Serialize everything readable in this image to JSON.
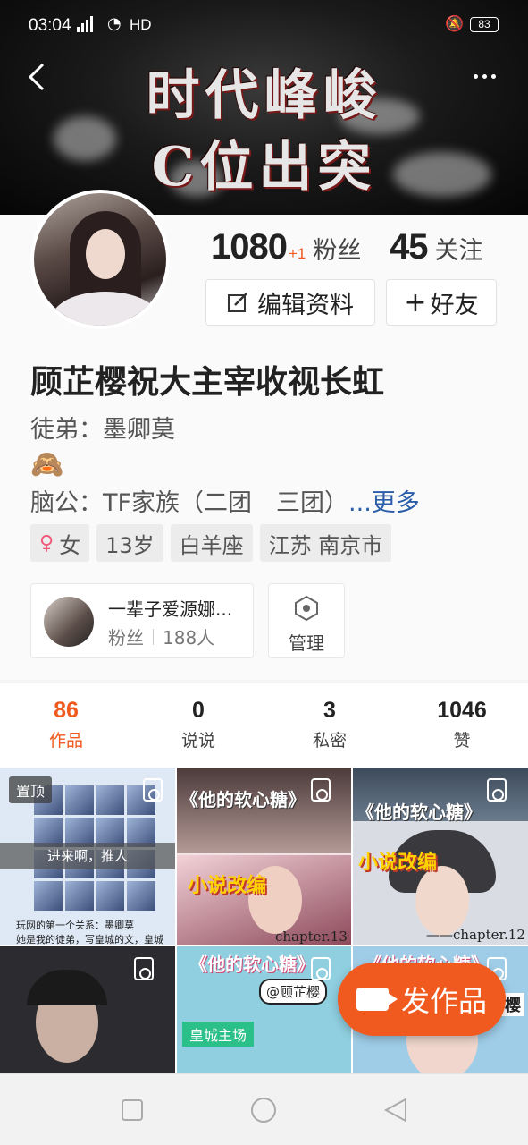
{
  "status_bar": {
    "time": "03:04",
    "network": "4G",
    "hd": "HD",
    "battery": "83"
  },
  "banner": {
    "line1": "时代峰峻",
    "line2": "C位出突"
  },
  "profile": {
    "fans_count": "1080",
    "fans_delta": "+1",
    "fans_label": "粉丝",
    "follow_count": "45",
    "follow_label": "关注",
    "edit_button": "编辑资料",
    "add_friend_button": "好友",
    "name": "顾芷樱祝大主宰收视长虹",
    "bio_line1": "徒弟：墨卿莫",
    "bio_line2": "🙈",
    "bio_line3": "脑公：TF家族（二团　三团）",
    "bio_more": "...更多",
    "tags": {
      "gender": "女",
      "age": "13岁",
      "zodiac": "白羊座",
      "location": "江苏 南京市"
    }
  },
  "group": {
    "name": "一辈子爱源娜...",
    "members_label": "粉丝",
    "members_count": "188人",
    "manage_label": "管理"
  },
  "tabs": [
    {
      "value": "86",
      "label": "作品"
    },
    {
      "value": "0",
      "label": "说说"
    },
    {
      "value": "3",
      "label": "私密"
    },
    {
      "value": "1046",
      "label": "赞"
    }
  ],
  "grid": {
    "pinned_label": "置顶",
    "cell1_overlay": "进来啊，推人",
    "cell1_caption1": "玩网的第一个关系：墨卿莫",
    "cell1_caption2": "她是我的徒弟，写皇城的文，皇城",
    "cell2_title": "《他的软心糖》",
    "cell2_novel": "小说改编",
    "cell2_chapter": "chapter.13",
    "cell3_title": "《他的软心糖》",
    "cell3_novel": "小说改编",
    "cell3_chapter": "——chapter.12",
    "cell5_title": "《他的软心糖》",
    "cell5_tag": "@顾芷樱",
    "cell5_sub": "皇城主场",
    "cell6_title": "《他的软心糖》",
    "cell6_tag": "樱"
  },
  "publish_button": "发作品"
}
